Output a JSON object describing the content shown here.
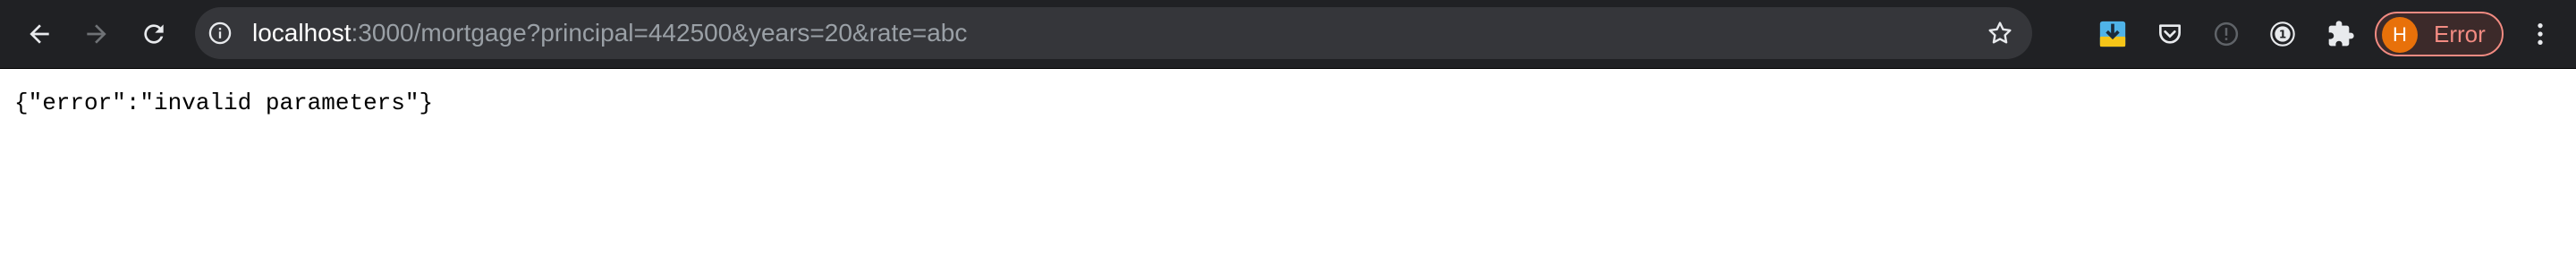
{
  "browser": {
    "url_host": "localhost",
    "url_rest": ":3000/mortgage?principal=442500&years=20&rate=abc",
    "profile_initial": "H",
    "profile_label": "Error",
    "colors": {
      "toolbar": "#202124",
      "omnibox": "#35363a",
      "error_accent": "#f28b82",
      "avatar": "#e8710a"
    },
    "icons": [
      "back-icon",
      "forward-icon",
      "reload-icon",
      "info-icon",
      "bookmark-star-icon",
      "download-extension-icon",
      "pocket-icon",
      "disabled-extension-icon",
      "password-manager-icon",
      "puzzle-icon",
      "menu-dots-icon"
    ]
  },
  "page": {
    "body_text": "{\"error\":\"invalid parameters\"}"
  }
}
